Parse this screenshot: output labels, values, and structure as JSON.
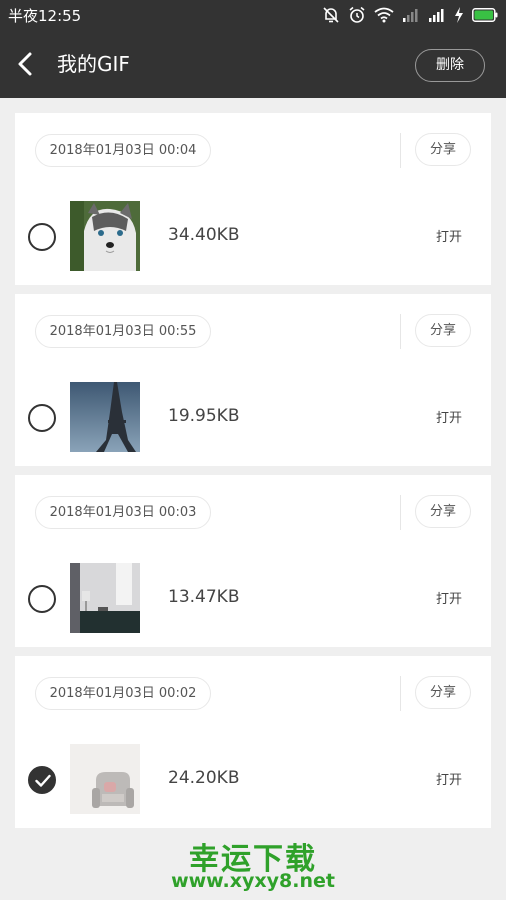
{
  "status_bar": {
    "time": "半夜12:55",
    "icons": [
      "mute-bell-icon",
      "alarm-icon",
      "wifi-icon",
      "signal-icon",
      "signal-icon",
      "charging-icon",
      "battery-icon"
    ]
  },
  "header": {
    "title": "我的GIF",
    "delete_label": "删除",
    "back_icon": "chevron-left-icon"
  },
  "items": [
    {
      "date": "2018年01月03日  00:04",
      "share_label": "分享",
      "size": "34.40KB",
      "open_label": "打开",
      "checked": false,
      "thumbnail": "husky-puppy"
    },
    {
      "date": "2018年01月03日  00:55",
      "share_label": "分享",
      "size": "19.95KB",
      "open_label": "打开",
      "checked": false,
      "thumbnail": "eiffel-tower"
    },
    {
      "date": "2018年01月03日  00:03",
      "share_label": "分享",
      "size": "13.47KB",
      "open_label": "打开",
      "checked": false,
      "thumbnail": "interior-room"
    },
    {
      "date": "2018年01月03日  00:02",
      "share_label": "分享",
      "size": "24.20KB",
      "open_label": "打开",
      "checked": true,
      "thumbnail": "armchair"
    }
  ],
  "watermark": {
    "title": "幸运下载",
    "url": "www.xyxy8.net"
  },
  "colors": {
    "header_bg": "#333333",
    "page_bg": "#efefef",
    "watermark": "#2fa12a"
  }
}
